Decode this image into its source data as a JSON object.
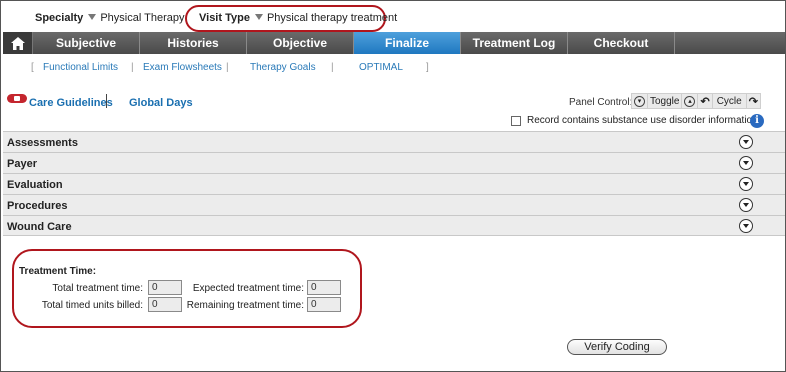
{
  "header": {
    "specialty_label": "Specialty",
    "specialty_value": "Physical Therapy",
    "visit_type_label": "Visit Type",
    "visit_type_value": "Physical therapy treatment"
  },
  "nav": {
    "home_icon": "home-icon",
    "tabs": [
      {
        "label": "Subjective"
      },
      {
        "label": "Histories"
      },
      {
        "label": "Objective"
      },
      {
        "label": "Finalize",
        "active": true
      },
      {
        "label": "Treatment Log"
      },
      {
        "label": "Checkout"
      }
    ]
  },
  "subnav": {
    "items": [
      "Functional Limits",
      "Exam Flowsheets",
      "Therapy Goals",
      "OPTIMAL"
    ]
  },
  "links": {
    "care_guidelines": "Care Guidelines",
    "global_days": "Global Days"
  },
  "panel_control": {
    "label": "Panel Control:",
    "toggle": "Toggle",
    "cycle": "Cycle"
  },
  "substance": {
    "label": "Record contains substance use disorder information"
  },
  "accordion": {
    "items": [
      "Assessments",
      "Payer",
      "Evaluation",
      "Procedures",
      "Wound Care"
    ]
  },
  "treatment_time": {
    "title": "Treatment Time:",
    "total_label": "Total treatment time:",
    "total_value": "0",
    "expected_label": "Expected treatment time:",
    "expected_value": "0",
    "units_label": "Total timed units billed:",
    "units_value": "0",
    "remaining_label": "Remaining treatment time:",
    "remaining_value": "0"
  },
  "verify_coding": "Verify Coding",
  "colors": {
    "accent": "#1f78c0",
    "annotation": "#b0161d",
    "nav_bg": "#4a4a4a"
  }
}
